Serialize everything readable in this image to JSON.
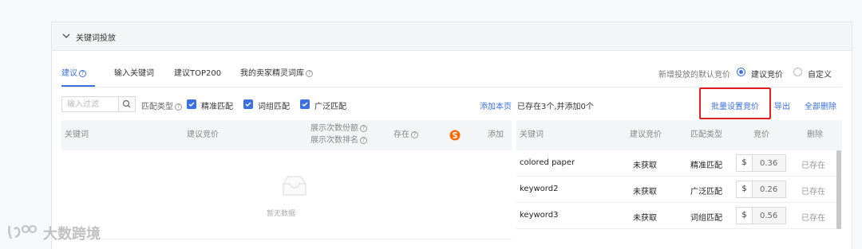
{
  "panel": {
    "title": "关键词投放"
  },
  "tabs": [
    {
      "label": "建议",
      "active": true
    },
    {
      "label": "输入关键词",
      "active": false
    },
    {
      "label": "建议TOP200",
      "active": false
    },
    {
      "label": "我的卖家精灵词库",
      "active": false
    }
  ],
  "default_bid": {
    "label": "新增投放的默认竞价",
    "options": [
      "建议竞价",
      "自定义"
    ],
    "selected": "建议竞价"
  },
  "filter": {
    "placeholder": "输入过滤",
    "value": "",
    "match_type_label": "匹配类型",
    "match_types": [
      {
        "label": "精准匹配",
        "checked": true
      },
      {
        "label": "词组匹配",
        "checked": true
      },
      {
        "label": "广泛匹配",
        "checked": true
      }
    ]
  },
  "actions": {
    "add_page": "添加本页",
    "status": "已存在3个,并添加0个",
    "bulk_bid": "批量设置竞价",
    "export": "导出",
    "delete_all": "全部删除"
  },
  "left_table": {
    "headers": {
      "keyword": "关键词",
      "suggested_bid": "建议竞价",
      "impression_share": "展示次数份额",
      "impression_rank": "展示次数排名",
      "exists": "存在",
      "add": "添加"
    },
    "empty_text": "暂无数据"
  },
  "right_table": {
    "headers": {
      "keyword": "关键词",
      "suggested_bid": "建议竞价",
      "match_type": "匹配类型",
      "bid": "竞价",
      "delete": "删除"
    },
    "rows": [
      {
        "keyword": "colored paper",
        "suggested_bid": "未获取",
        "match_type": "精准匹配",
        "currency": "$",
        "bid": "0.36",
        "status": "已存在"
      },
      {
        "keyword": "keyword2",
        "suggested_bid": "未获取",
        "match_type": "广泛匹配",
        "currency": "$",
        "bid": "0.26",
        "status": "已存在"
      },
      {
        "keyword": "keyword3",
        "suggested_bid": "未获取",
        "match_type": "词组匹配",
        "currency": "$",
        "bid": "0.56",
        "status": "已存在"
      }
    ]
  },
  "watermark": "大数跨境",
  "colors": {
    "accent": "#3b6fe2",
    "highlight_box": "#e02020",
    "brand_icon": "#ff6a00"
  },
  "icons": {
    "collapse": "chevron-down-icon",
    "search": "search-icon",
    "help": "question-circle-icon",
    "brand": "sellersprite-logo-icon",
    "empty": "empty-inbox-icon"
  }
}
